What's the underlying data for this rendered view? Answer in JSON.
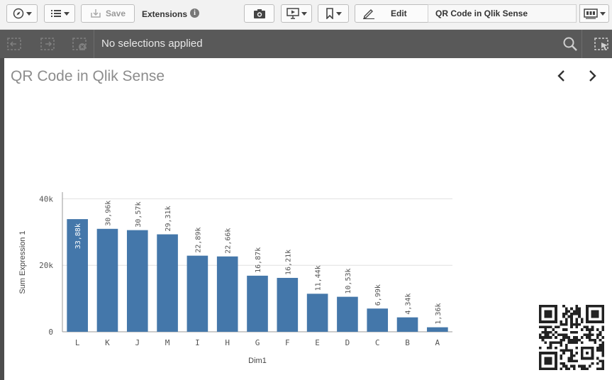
{
  "toolbar": {
    "navigation_icon": "compass-icon",
    "list_icon": "list-icon",
    "save_label": "Save",
    "extensions_label": "Extensions",
    "info_icon": "info-icon",
    "info_glyph": "i",
    "snapshot_icon": "camera-icon",
    "present_icon": "presentation-icon",
    "bookmark_icon": "bookmark-icon",
    "edit_label": "Edit",
    "sheet_title": "QR Code in Qlik Sense",
    "sheet_menu_icon": "sheets-icon"
  },
  "selections": {
    "status_text": "No selections applied"
  },
  "sheet": {
    "title": "QR Code in Qlik Sense"
  },
  "chart_data": {
    "type": "bar",
    "categories": [
      "L",
      "K",
      "J",
      "M",
      "I",
      "H",
      "G",
      "F",
      "E",
      "D",
      "C",
      "B",
      "A"
    ],
    "values": [
      33880,
      30960,
      30570,
      29310,
      22890,
      22660,
      16870,
      16210,
      11440,
      10530,
      6990,
      4340,
      1360
    ],
    "labels": [
      "33,88k",
      "30,96k",
      "30,57k",
      "29,31k",
      "22,89k",
      "22,66k",
      "16,87k",
      "16,21k",
      "11,44k",
      "10,53k",
      "6,99k",
      "4,34k",
      "1,36k"
    ],
    "yticks": [
      "0",
      "20k",
      "40k"
    ],
    "ytick_values": [
      0,
      20000,
      40000
    ],
    "ylim": [
      0,
      42000
    ],
    "xlabel": "Dim1",
    "ylabel": "Sum Expression 1",
    "bar_color": "#4477aa",
    "grid": true
  }
}
